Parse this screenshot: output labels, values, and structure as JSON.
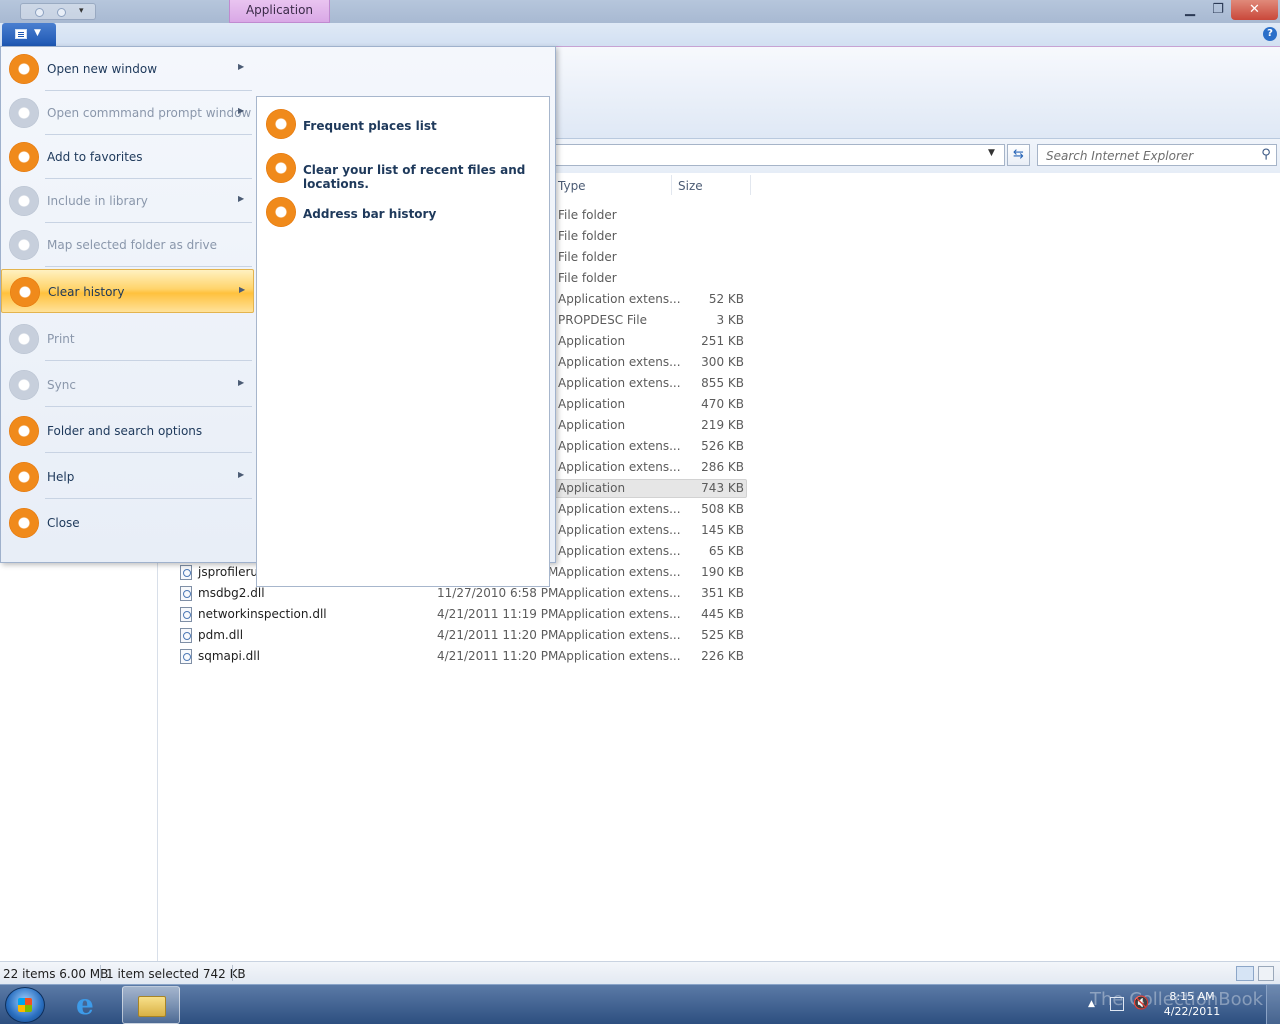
{
  "window": {
    "contextual_tab": "Application Tools",
    "minimize_icon": "minimize-icon",
    "maximize_icon": "restore-icon",
    "close_icon": "close-icon",
    "help_label": "?"
  },
  "toolbar": {
    "search_placeholder": "Search Internet Explorer",
    "refresh_icon": "refresh-icon"
  },
  "list": {
    "columns": [
      "Type",
      "Size"
    ],
    "rows": [
      {
        "name": "",
        "date": "",
        "type": "File folder",
        "size": ""
      },
      {
        "name": "",
        "date": "",
        "type": "File folder",
        "size": ""
      },
      {
        "name": "",
        "date": "",
        "type": "File folder",
        "size": ""
      },
      {
        "name": "",
        "date": "",
        "type": "File folder",
        "size": ""
      },
      {
        "name": "",
        "date": "",
        "type": "Application extens...",
        "size": "52 KB"
      },
      {
        "name": "",
        "date": "",
        "type": "PROPDESC File",
        "size": "3 KB"
      },
      {
        "name": "",
        "date": "",
        "type": "Application",
        "size": "251 KB"
      },
      {
        "name": "",
        "date": "",
        "type": "Application extens...",
        "size": "300 KB"
      },
      {
        "name": "",
        "date": "",
        "type": "Application extens...",
        "size": "855 KB"
      },
      {
        "name": "",
        "date": "",
        "type": "Application",
        "size": "470 KB"
      },
      {
        "name": "",
        "date": "",
        "type": "Application",
        "size": "219 KB"
      },
      {
        "name": "",
        "date": "",
        "type": "Application extens...",
        "size": "526 KB"
      },
      {
        "name": "",
        "date": "",
        "type": "Application extens...",
        "size": "286 KB"
      },
      {
        "name": "",
        "date": "",
        "type": "Application",
        "size": "743 KB",
        "selected": true
      },
      {
        "name": "",
        "date": "",
        "type": "Application extens...",
        "size": "508 KB"
      },
      {
        "name": "",
        "date": "",
        "type": "Application extens...",
        "size": "145 KB"
      },
      {
        "name": "",
        "date": "",
        "type": "Application extens...",
        "size": "65 KB"
      },
      {
        "name": "jsprofilerui.dll",
        "date": "4/21/2011 11:18 PM",
        "type": "Application extens...",
        "size": "190 KB"
      },
      {
        "name": "msdbg2.dll",
        "date": "11/27/2010 6:58 PM",
        "type": "Application extens...",
        "size": "351 KB"
      },
      {
        "name": "networkinspection.dll",
        "date": "4/21/2011 11:19 PM",
        "type": "Application extens...",
        "size": "445 KB"
      },
      {
        "name": "pdm.dll",
        "date": "4/21/2011 11:20 PM",
        "type": "Application extens...",
        "size": "525 KB"
      },
      {
        "name": "sqmapi.dll",
        "date": "4/21/2011 11:20 PM",
        "type": "Application extens...",
        "size": "226 KB"
      }
    ]
  },
  "app_menu": {
    "items": [
      {
        "label": "Open new window",
        "enabled": true,
        "submenu": true
      },
      {
        "label": "Open commmand prompt window",
        "enabled": false,
        "submenu": true
      },
      {
        "label": "Add to favorites",
        "enabled": true,
        "submenu": false
      },
      {
        "label": "Include in library",
        "enabled": false,
        "submenu": true
      },
      {
        "label": "Map selected folder as drive",
        "enabled": false,
        "submenu": false
      },
      {
        "label": "Clear history",
        "enabled": true,
        "submenu": true,
        "highlighted": true
      },
      {
        "label": "Print",
        "enabled": false,
        "submenu": false
      },
      {
        "label": "Sync",
        "enabled": false,
        "submenu": true
      },
      {
        "label": "Folder and search options",
        "enabled": true,
        "submenu": false
      },
      {
        "label": "Help",
        "enabled": true,
        "submenu": true
      },
      {
        "label": "Close",
        "enabled": true,
        "submenu": false
      }
    ],
    "submenu_items": [
      {
        "label": "Frequent places list"
      },
      {
        "label": "Clear your list of recent files and locations."
      },
      {
        "label": "Address bar history"
      }
    ]
  },
  "status": {
    "items": "22 items  6.00 MB",
    "selection": "1 item selected  742 KB"
  },
  "taskbar": {
    "time": "8:15 AM",
    "date": "4/22/2011",
    "watermark": "The CollectionBook"
  },
  "colors": {
    "accent": "#f08a1b",
    "ribbon": "#dfe8f5",
    "contextual": "#d9a8e6",
    "taskbar": "#2d4f80"
  }
}
